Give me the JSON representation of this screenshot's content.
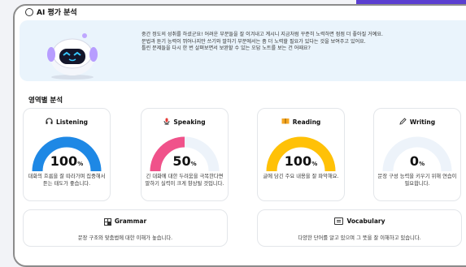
{
  "header": {
    "title": "AI 평가 분석"
  },
  "intro": {
    "lines": [
      "중간 정도의 성취를 하셨군요! 어려운 부분들을 잘 이겨내고 계시니 지금처럼 꾸준히 노력하면 점점 더 좋아질 거예요.",
      "문법과 듣기 능력이 뛰어나지만 쓰기와 말하기 부분에서는 좀 더 노력할 필요가 있다는 것을 보여주고 있어요.",
      "틀린 문제들을 다시 한 번 살펴보면서 보완할 수 있는 오답 노트를 보는 건 어때요?"
    ]
  },
  "section": {
    "title": "영역별 분석"
  },
  "cards": [
    {
      "label": "Listening",
      "value": "100",
      "unit": "%",
      "progress": 1.0,
      "color": "#1e88e5",
      "icon": "headphones-icon",
      "desc": "대화의 흐름을 잘 따라가며 집중해서 듣는 태도가 좋습니다."
    },
    {
      "label": "Speaking",
      "value": "50",
      "unit": "%",
      "progress": 0.5,
      "color": "#f0528a",
      "icon": "microphone-icon",
      "desc": "긴 대화에 대한 두려움을 극복한다면 말하기 실력이 크게 향상될 것입니다."
    },
    {
      "label": "Reading",
      "value": "100",
      "unit": "%",
      "progress": 1.0,
      "color": "#ffc107",
      "icon": "book-icon",
      "desc": "글에 담긴 주요 내용을 잘 파악해요."
    },
    {
      "label": "Writing",
      "value": "0",
      "unit": "%",
      "progress": 0.0,
      "color": "#1e88e5",
      "icon": "pencil-icon",
      "desc": "문장 구성 능력을 키우기 위해 연습이 필요합니다."
    }
  ],
  "grammar": {
    "label": "Grammar",
    "icon": "grid-icon",
    "desc": "문장 구조와 맞춤법에 대한 이해가 높습니다."
  },
  "vocabulary": {
    "label": "Vocabulary",
    "icon": "card-icon",
    "desc": "다양한 단어를 알고 있으며 그 뜻을 잘 이해하고 있습니다."
  },
  "colors": {
    "gauge_track": "#edf3fa",
    "intro_bg": "#eaf4fc",
    "accent_purple": "#5b3fd0"
  }
}
